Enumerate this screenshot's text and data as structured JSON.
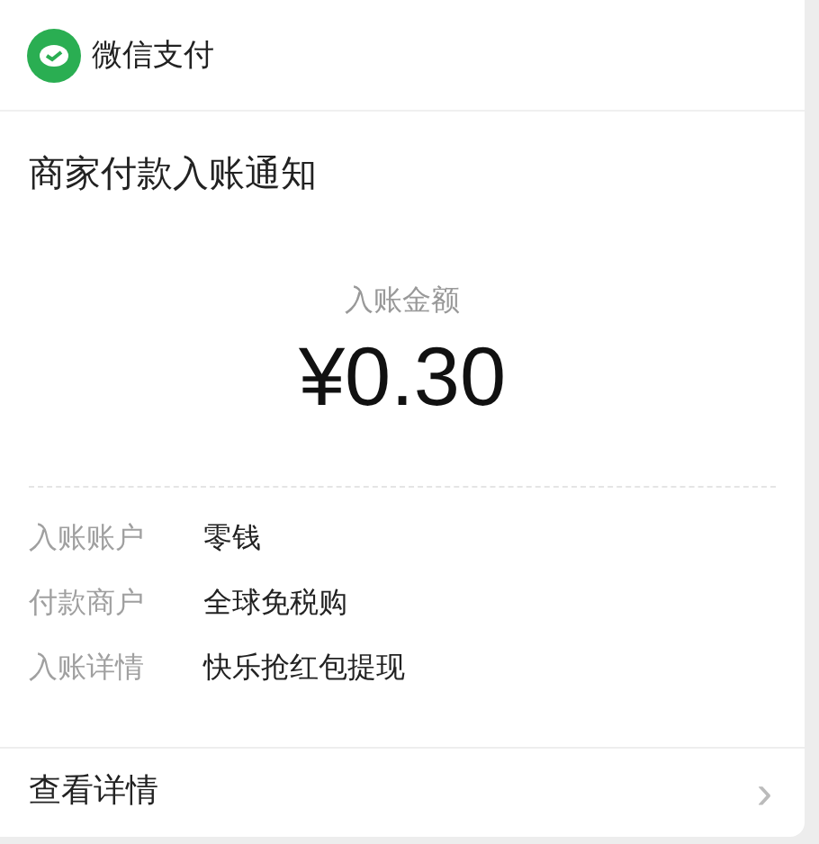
{
  "app": {
    "name": "微信支付"
  },
  "title": "商家付款入账通知",
  "amount": {
    "label": "入账金额",
    "value": "¥0.30"
  },
  "details": [
    {
      "label": "入账账户",
      "value": "零钱"
    },
    {
      "label": "付款商户",
      "value": "全球免税购"
    },
    {
      "label": "入账详情",
      "value": "快乐抢红包提现"
    }
  ],
  "footer": {
    "link": "查看详情",
    "chevron": "›"
  }
}
